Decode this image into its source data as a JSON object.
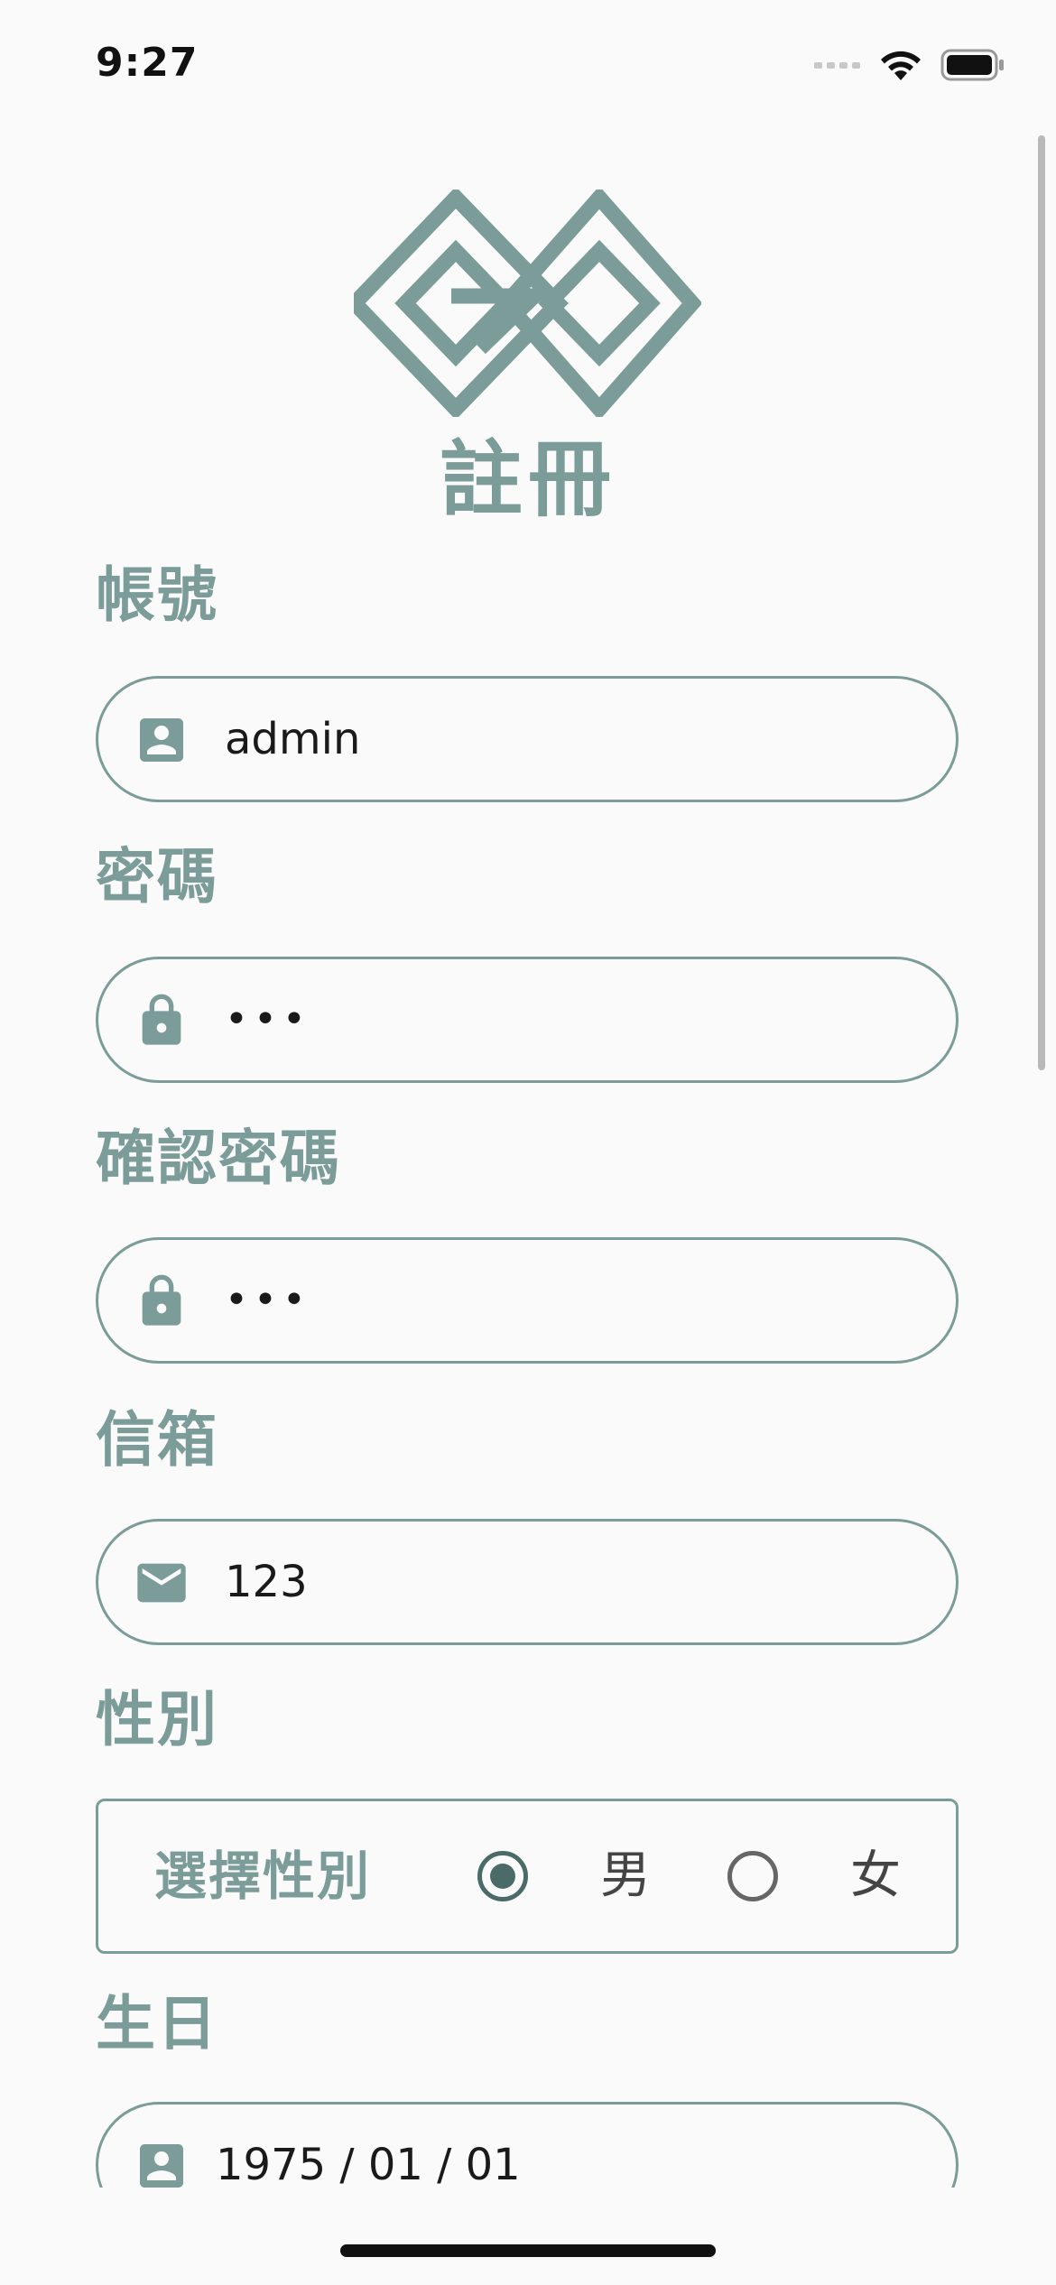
{
  "status_bar": {
    "time": "9:27"
  },
  "page": {
    "title": "註冊"
  },
  "form": {
    "account": {
      "label": "帳號",
      "value": "admin",
      "icon": "account-box-icon"
    },
    "password": {
      "label": "密碼",
      "value": "•••",
      "icon": "lock-icon"
    },
    "confirm_password": {
      "label": "確認密碼",
      "value": "•••",
      "icon": "lock-icon"
    },
    "email": {
      "label": "信箱",
      "value": "123",
      "icon": "mail-icon"
    },
    "gender": {
      "label": "性別",
      "prompt": "選擇性別",
      "options": [
        {
          "label": "男",
          "selected": true
        },
        {
          "label": "女",
          "selected": false
        }
      ]
    },
    "birthday": {
      "label": "生日",
      "value": "1975 / 01 / 01",
      "icon": "account-box-icon"
    }
  },
  "colors": {
    "accent": "#7b9c99",
    "accent_dark": "#4a6b67",
    "background": "#fafafa"
  }
}
